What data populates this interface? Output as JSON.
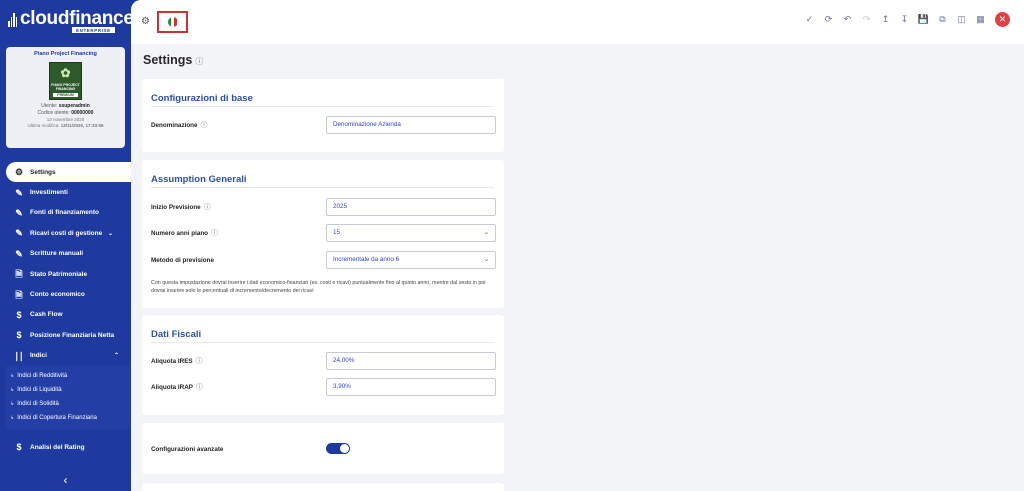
{
  "brand": {
    "name": "cloudfinance",
    "sub": "ENTERPRISE"
  },
  "profile": {
    "title": "Piano Project Financing",
    "badge_lines": "PIANO PROJECT FINANCING",
    "badge_tag": "PREMIUM",
    "user_label": "Utente:",
    "user": "ssuperadmin",
    "code_label": "Codice utente:",
    "code": "00000000",
    "date": "13 novembre 2025",
    "modified_label": "Ultima modifica:",
    "modified": "13/11/2025, 17:33:55"
  },
  "sidebar": {
    "items": [
      {
        "label": "Settings",
        "icon": "gear-icon"
      },
      {
        "label": "Investimenti",
        "icon": "edit-icon"
      },
      {
        "label": "Fonti di finanziamento",
        "icon": "edit-icon"
      },
      {
        "label": "Ricavi costi di gestione",
        "icon": "edit-icon"
      },
      {
        "label": "Scritture manuali",
        "icon": "edit-icon"
      },
      {
        "label": "Stato Patrimoniale",
        "icon": "document-icon"
      },
      {
        "label": "Conto economico",
        "icon": "document-icon"
      },
      {
        "label": "Cash Flow",
        "icon": "dollar-icon"
      },
      {
        "label": "Posizione Finanziaria Netta",
        "icon": "dollar-icon"
      },
      {
        "label": "Indici",
        "icon": "bar-chart-icon"
      }
    ],
    "subitems": [
      "Indici di Redditività",
      "Indici di Liquidità",
      "Indici di Solidità",
      "Indici di Copertura Finanziaria"
    ],
    "after": [
      {
        "label": "Analisi del Rating",
        "icon": "dollar-icon"
      }
    ]
  },
  "page": {
    "title": "Settings"
  },
  "sections": {
    "base": {
      "title": "Configurazioni di base",
      "denominazione_label": "Denominazione",
      "denominazione_value": "Denominazione Azienda"
    },
    "assumption": {
      "title": "Assumption Generali",
      "inizio_label": "Inizio Previsione",
      "inizio_value": "2025",
      "anni_label": "Numero anni piano",
      "anni_value": "15",
      "metodo_label": "Metodo di previsione",
      "metodo_value": "Incrementale da anno 6",
      "note": "Con questa impostazione dovrai inserire i dati economico-finanziari (es. costi e ricavi) puntualmente fino al quinto anno, mentre dal sesto in poi dovrai inserire solo le percentuali di incremento/decremento dei ricavi"
    },
    "fiscali": {
      "title": "Dati Fiscali",
      "ires_label": "Aliquota IRES",
      "ires_value": "24,00%",
      "irap_label": "Aliquota IRAP",
      "irap_value": "3,90%"
    },
    "avanzate": {
      "label": "Configurazioni avanzate",
      "enabled": true
    }
  },
  "colors": {
    "primary": "#1e3a9e",
    "accent": "#2d4fa3",
    "close": "#e34040",
    "flag_border": "#d0322f"
  }
}
